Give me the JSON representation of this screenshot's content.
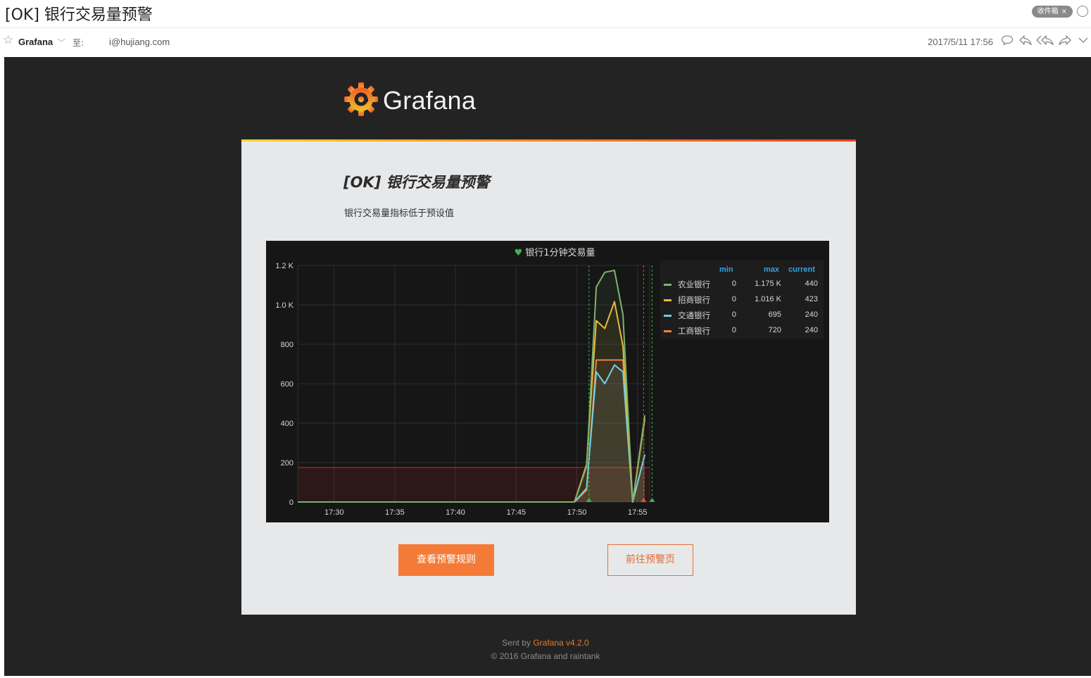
{
  "mail": {
    "subject": "[OK] 银行交易量预警",
    "folder_badge": "收件箱",
    "folder_close": "×",
    "sender": "Grafana",
    "to_label": "至:",
    "to_address": "i@hujiang.com",
    "date": "2017/5/11 17:56",
    "icons": [
      "star-icon",
      "chevron-down-icon",
      "comment-icon",
      "reply-icon",
      "reply-all-icon",
      "forward-icon",
      "more-chevron-icon"
    ]
  },
  "email": {
    "logo_text": "Grafana",
    "title": "[OK] 银行交易量预警",
    "message": "银行交易量指标低于预设值",
    "panel": {
      "title": "银行1分钟交易量",
      "legend_headers": {
        "min": "min",
        "max": "max",
        "current": "current"
      },
      "legend": [
        {
          "name": "农业银行",
          "min": "0",
          "max": "1.175 K",
          "current": "440",
          "color": "#7eb26d"
        },
        {
          "name": "招商银行",
          "min": "0",
          "max": "1.016 K",
          "current": "423",
          "color": "#eab839"
        },
        {
          "name": "交通银行",
          "min": "0",
          "max": "695",
          "current": "240",
          "color": "#6ed0e0"
        },
        {
          "name": "工商银行",
          "min": "0",
          "max": "720",
          "current": "240",
          "color": "#ef843c"
        }
      ]
    },
    "buttons": {
      "view_rule": "查看预警规则",
      "go_alert_page": "前往预警页"
    },
    "footer": {
      "sent_by": "Sent by",
      "brand": "Grafana v4.2.0",
      "copyright": "© 2016 Grafana and raintank"
    }
  },
  "chart_data": {
    "type": "line",
    "title": "银行1分钟交易量",
    "x": [
      "17:27",
      "17:49",
      "17:50",
      "17:51",
      "17:52",
      "17:53",
      "17:54",
      "17:55",
      "17:56"
    ],
    "xticks": [
      "17:30",
      "17:35",
      "17:40",
      "17:45",
      "17:50",
      "17:55"
    ],
    "yticks": [
      "0",
      "200",
      "400",
      "600",
      "800",
      "1.0 K",
      "1.2 K"
    ],
    "ylim": [
      0,
      1200
    ],
    "threshold": 175,
    "series": [
      {
        "name": "农业银行",
        "color": "#7eb26d",
        "points": [
          [
            "17:27",
            0
          ],
          [
            "17:49.8",
            0
          ],
          [
            "17:50.8",
            180
          ],
          [
            "17:51.6",
            1090
          ],
          [
            "17:52.3",
            1165
          ],
          [
            "17:53.1",
            1175
          ],
          [
            "17:53.8",
            950
          ],
          [
            "17:54.6",
            0
          ],
          [
            "17:55.6",
            440
          ]
        ]
      },
      {
        "name": "招商银行",
        "color": "#eab839",
        "points": [
          [
            "17:27",
            0
          ],
          [
            "17:49.8",
            0
          ],
          [
            "17:50.8",
            190
          ],
          [
            "17:51.6",
            920
          ],
          [
            "17:52.3",
            880
          ],
          [
            "17:53.1",
            1016
          ],
          [
            "17:53.8",
            790
          ],
          [
            "17:54.6",
            0
          ],
          [
            "17:55.6",
            423
          ]
        ]
      },
      {
        "name": "交通银行",
        "color": "#6ed0e0",
        "points": [
          [
            "17:27",
            0
          ],
          [
            "17:49.8",
            0
          ],
          [
            "17:50.8",
            70
          ],
          [
            "17:51.6",
            660
          ],
          [
            "17:52.3",
            600
          ],
          [
            "17:53.1",
            695
          ],
          [
            "17:53.8",
            660
          ],
          [
            "17:54.6",
            0
          ],
          [
            "17:55.6",
            240
          ]
        ]
      },
      {
        "name": "工商银行",
        "color": "#ef843c",
        "points": [
          [
            "17:27",
            0
          ],
          [
            "17:49.8",
            0
          ],
          [
            "17:50.8",
            60
          ],
          [
            "17:51.6",
            720
          ],
          [
            "17:52.3",
            720
          ],
          [
            "17:53.1",
            720
          ],
          [
            "17:53.8",
            720
          ],
          [
            "17:54.6",
            0
          ],
          [
            "17:55.6",
            240
          ]
        ]
      }
    ],
    "annotations": [
      {
        "x": "17:51",
        "type": "ok",
        "color": "#3fb34f"
      },
      {
        "x": "17:55.5",
        "type": "alerting",
        "color": "#e24d42"
      },
      {
        "x": "17:56.2",
        "type": "ok",
        "color": "#3fb34f"
      }
    ],
    "legend": "right"
  }
}
